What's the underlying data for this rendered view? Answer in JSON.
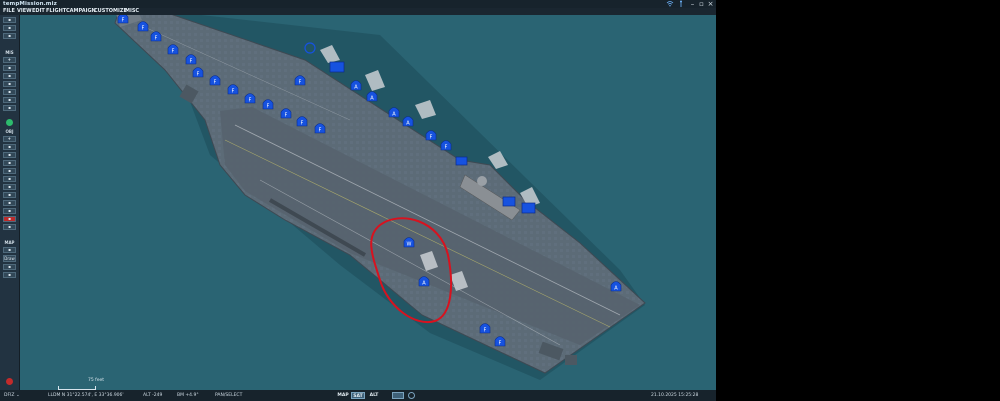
{
  "app": {
    "title": "tempMission.miz"
  },
  "menu": {
    "items": [
      "FILE",
      "VIEW",
      "EDIT",
      "FLIGHT",
      "CAMPAIGN",
      "CUSTOMIZE",
      "MISC"
    ]
  },
  "toolbar": {
    "section_mis": "MIS",
    "section_obj": "OBJ",
    "section_map": "MAP",
    "draw_label": "Draw"
  },
  "map": {
    "scale_label": "75 feet",
    "unit_markers": [
      "F",
      "F",
      "F",
      "F",
      "F",
      "F",
      "F",
      "F",
      "F",
      "F",
      "F",
      "F",
      "F",
      "F",
      "A",
      "A",
      "A",
      "A",
      "F",
      "F",
      "W",
      "A",
      "A",
      "F",
      "F"
    ]
  },
  "status": {
    "dfiz_label": "DFIZ",
    "coords": "LLDM  N 31°22.574', E 33°36.906'",
    "alt": "ALT  -249",
    "bm": "BM  +4.9°",
    "mode": "PAN/SELECT",
    "view_modes": [
      "MAP",
      "SAT",
      "ALT"
    ],
    "active_view": "SAT",
    "datetime": "21.10.2025 15:25:28"
  },
  "colors": {
    "sea": "#2a6473",
    "deck": "#5b6a76",
    "unit_marker": "#1652e0",
    "highlight_circle": "#d8121f"
  }
}
